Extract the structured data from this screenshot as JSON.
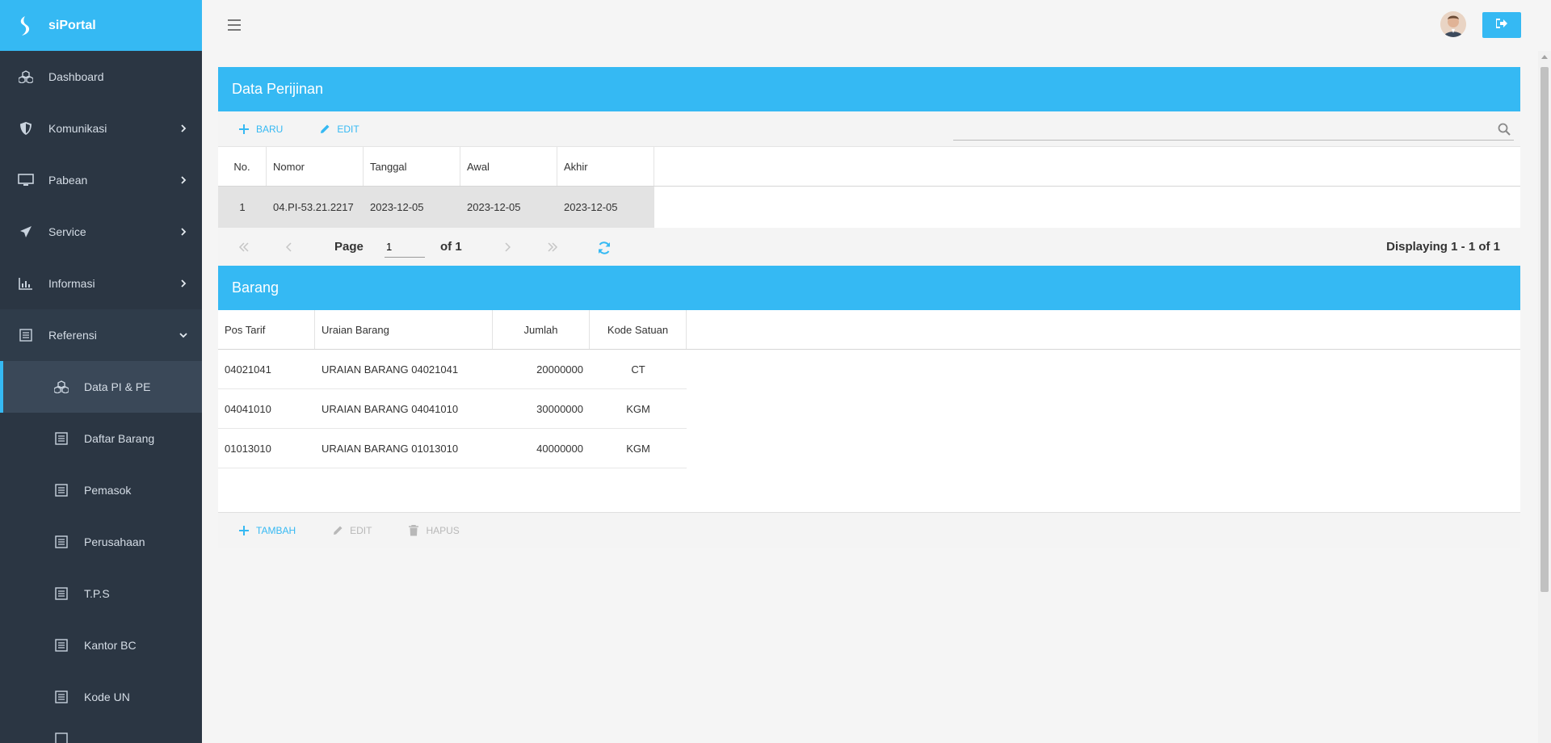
{
  "app": {
    "name": "siPortal"
  },
  "sidebar": {
    "items": [
      {
        "label": "Dashboard",
        "icon": "cubes-icon"
      },
      {
        "label": "Komunikasi",
        "icon": "shield-icon"
      },
      {
        "label": "Pabean",
        "icon": "monitor-icon"
      },
      {
        "label": "Service",
        "icon": "paper-plane-icon"
      },
      {
        "label": "Informasi",
        "icon": "bar-chart-icon"
      },
      {
        "label": "Referensi",
        "icon": "list-icon"
      }
    ],
    "sub_items": [
      {
        "label": "Data PI & PE",
        "icon": "cubes-icon"
      },
      {
        "label": "Daftar Barang",
        "icon": "list-icon"
      },
      {
        "label": "Pemasok",
        "icon": "list-icon"
      },
      {
        "label": "Perusahaan",
        "icon": "list-icon"
      },
      {
        "label": "T.P.S",
        "icon": "list-icon"
      },
      {
        "label": "Kantor BC",
        "icon": "list-icon"
      },
      {
        "label": "Kode UN",
        "icon": "list-icon"
      }
    ]
  },
  "perijinan": {
    "title": "Data Perijinan",
    "toolbar": {
      "new_label": "BARU",
      "edit_label": "EDIT",
      "search_placeholder": ""
    },
    "columns": [
      "No.",
      "Nomor",
      "Tanggal",
      "Awal",
      "Akhir"
    ],
    "rows": [
      {
        "no": "1",
        "nomor": "04.PI-53.21.2217",
        "tanggal": "2023-12-05",
        "awal": "2023-12-05",
        "akhir": "2023-12-05"
      }
    ],
    "pager": {
      "page_label": "Page",
      "page_value": "1",
      "of_label": "of 1",
      "display": "Displaying 1 - 1 of 1"
    }
  },
  "barang": {
    "title": "Barang",
    "columns": [
      "Pos Tarif",
      "Uraian Barang",
      "Jumlah",
      "Kode Satuan"
    ],
    "rows": [
      {
        "pos": "04021041",
        "uraian": "URAIAN BARANG 04021041",
        "jumlah": "20000000",
        "satuan": "CT"
      },
      {
        "pos": "04041010",
        "uraian": "URAIAN BARANG 04041010",
        "jumlah": "30000000",
        "satuan": "KGM"
      },
      {
        "pos": "01013010",
        "uraian": "URAIAN BARANG 01013010",
        "jumlah": "40000000",
        "satuan": "KGM"
      }
    ],
    "toolbar": {
      "add_label": "TAMBAH",
      "edit_label": "EDIT",
      "delete_label": "HAPUS"
    }
  },
  "colors": {
    "accent": "#35b9f3",
    "sidebar": "#2b3643"
  }
}
